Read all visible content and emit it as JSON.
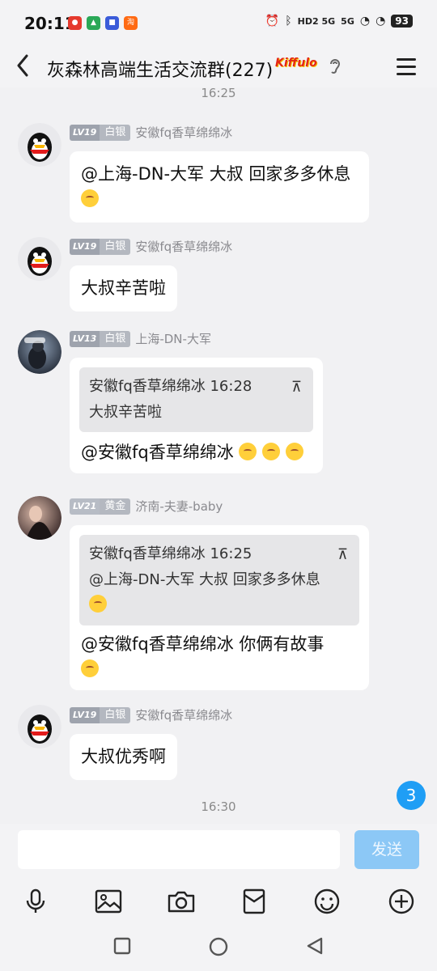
{
  "status_bar": {
    "time": "20:11",
    "signal1": "HD2 5G",
    "signal2": "5G",
    "battery": "93"
  },
  "header": {
    "title": "灰森林高端生活交流群(227)",
    "badge_text": "Kiffulo"
  },
  "timestamps": {
    "top": "16:25",
    "bottom": "16:30"
  },
  "messages": [
    {
      "level": "LV19",
      "rank": "白银",
      "name": "安徽fq香草绵绵冰",
      "text": "@上海-DN-大军  大叔 回家多多休息"
    },
    {
      "level": "LV19",
      "rank": "白银",
      "name": "安徽fq香草绵绵冰",
      "text": "大叔辛苦啦"
    },
    {
      "level": "LV13",
      "rank": "白银",
      "name": "上海-DN-大军",
      "quote_header": "安徽fq香草绵绵冰 16:28",
      "quote_text": "大叔辛苦啦",
      "text": "@安徽fq香草绵绵冰 "
    },
    {
      "level": "LV21",
      "rank": "黄金",
      "name": "济南-夫妻-baby",
      "quote_header": "安徽fq香草绵绵冰 16:25",
      "quote_text": "@上海-DN-大军  大叔 回家多多休息",
      "text": "@安徽fq香草绵绵冰 你俩有故事"
    },
    {
      "level": "LV19",
      "rank": "白银",
      "name": "安徽fq香草绵绵冰",
      "text": "大叔优秀啊"
    }
  ],
  "unread_count": "3",
  "composer": {
    "input_value": "",
    "send_label": "发送"
  },
  "colors": {
    "send": "#8cc8f6",
    "unread": "#1f9ef5"
  }
}
